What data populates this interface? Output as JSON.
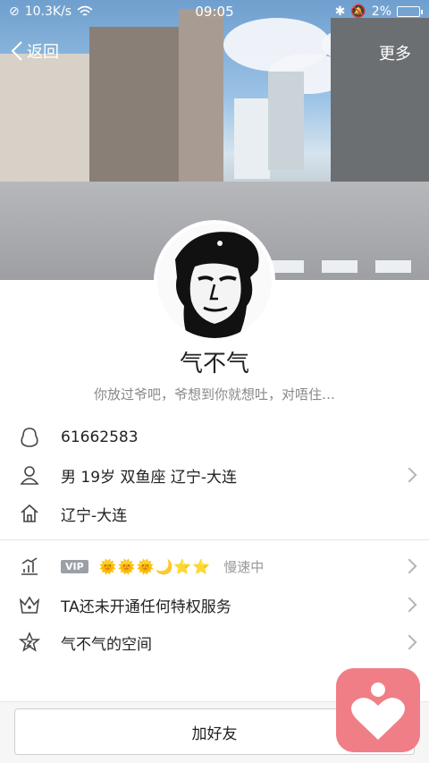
{
  "status_bar": {
    "speed": "10.3K/s",
    "time": "09:05",
    "battery": "2%"
  },
  "nav": {
    "back_label": "返回",
    "more_label": "更多"
  },
  "profile": {
    "name": "气不气",
    "signature": "你放过爷吧，爷想到你就想吐，对唔住…"
  },
  "info": {
    "qq_number": "61662583",
    "basic": "男  19岁  双鱼座  辽宁-大连",
    "hometown": "辽宁-大连"
  },
  "vip": {
    "badge": "VIP",
    "level_icons": "🌞🌞🌞🌙⭐⭐",
    "status": "慢速中"
  },
  "privilege": {
    "label": "TA还未开通任何特权服务"
  },
  "space": {
    "label": "气不气的空间"
  },
  "actions": {
    "add_friend": "加好友"
  },
  "colors": {
    "float_app": "#f07e86",
    "level_gold": "#f2b700"
  }
}
